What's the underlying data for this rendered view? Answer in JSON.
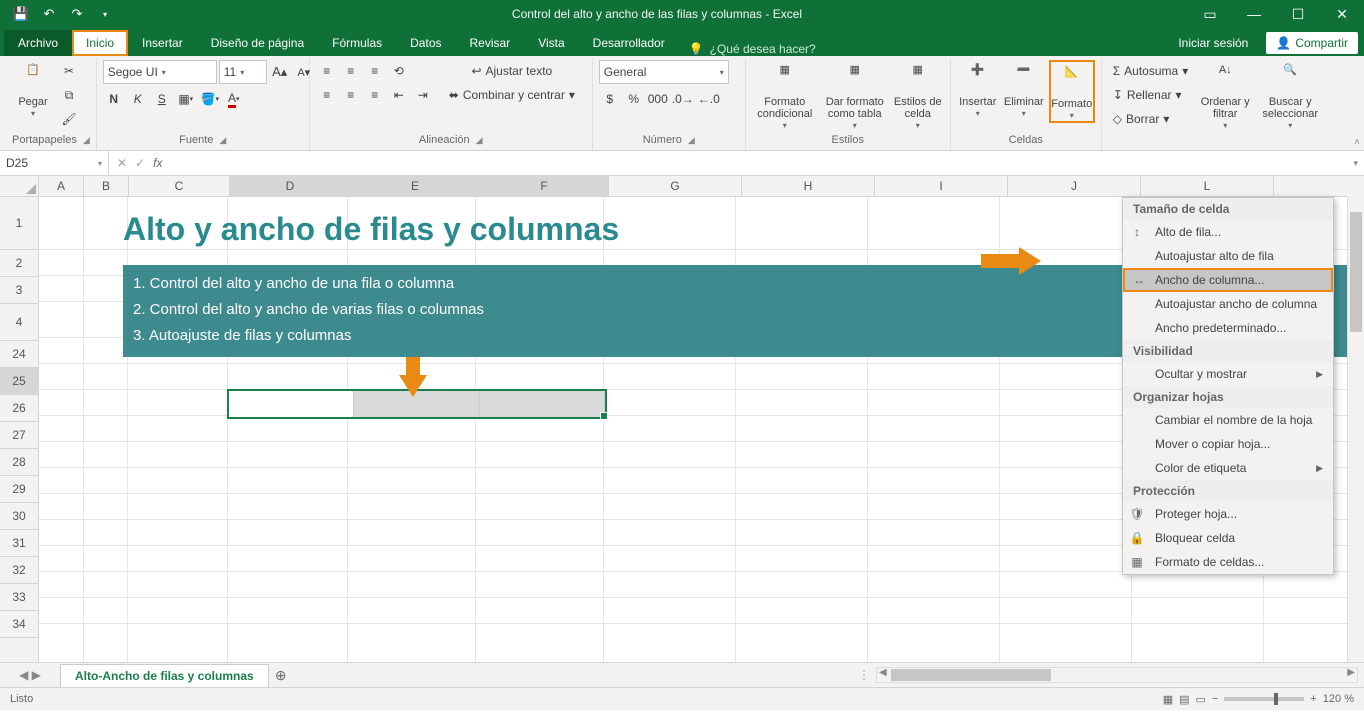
{
  "titlebar": {
    "title": "Control del alto y ancho de las filas y columnas - Excel"
  },
  "tabs": {
    "file": "Archivo",
    "list": [
      "Inicio",
      "Insertar",
      "Diseño de página",
      "Fórmulas",
      "Datos",
      "Revisar",
      "Vista",
      "Desarrollador"
    ],
    "active": "Inicio",
    "tellme_placeholder": "¿Qué desea hacer?",
    "signin": "Iniciar sesión",
    "share": "Compartir"
  },
  "ribbon": {
    "clipboard": {
      "paste": "Pegar",
      "label": "Portapapeles"
    },
    "font": {
      "name": "Segoe UI",
      "size": "11",
      "bold": "N",
      "italic": "K",
      "underline": "S",
      "label": "Fuente"
    },
    "alignment": {
      "wrap": "Ajustar texto",
      "merge": "Combinar y centrar",
      "label": "Alineación"
    },
    "number": {
      "format": "General",
      "label": "Número"
    },
    "styles": {
      "cond": "Formato condicional",
      "table": "Dar formato como tabla",
      "cell": "Estilos de celda",
      "label": "Estilos"
    },
    "cells": {
      "insert": "Insertar",
      "delete": "Eliminar",
      "format": "Formato",
      "label": "Celdas"
    },
    "editing": {
      "sum": "Autosuma",
      "fill": "Rellenar",
      "clear": "Borrar",
      "sort": "Ordenar y filtrar",
      "find": "Buscar y seleccionar"
    }
  },
  "namebox": {
    "ref": "D25"
  },
  "columns": [
    "A",
    "B",
    "C",
    "D",
    "E",
    "F",
    "G",
    "H",
    "I",
    "J",
    "L"
  ],
  "rows_top": [
    "1",
    "2",
    "3",
    "4"
  ],
  "rows_bottom": [
    "24",
    "25",
    "26",
    "27",
    "28",
    "29",
    "30",
    "31",
    "32",
    "33",
    "34"
  ],
  "sheet": {
    "title": "Alto y ancho de filas y columnas",
    "lines": [
      "1. Control del alto y ancho de una fila o columna",
      "2. Control del alto y ancho de varias filas o columnas",
      "3. Autoajuste de filas y columnas"
    ]
  },
  "menu": {
    "h1": "Tamaño de celda",
    "i1": "Alto de fila...",
    "i2": "Autoajustar alto de fila",
    "i3": "Ancho de columna...",
    "i4": "Autoajustar ancho de columna",
    "i5": "Ancho predeterminado...",
    "h2": "Visibilidad",
    "i6": "Ocultar y mostrar",
    "h3": "Organizar hojas",
    "i7": "Cambiar el nombre de la hoja",
    "i8": "Mover o copiar hoja...",
    "i9": "Color de etiqueta",
    "h4": "Protección",
    "i10": "Proteger hoja...",
    "i11": "Bloquear celda",
    "i12": "Formato de celdas..."
  },
  "sheettab": {
    "name": "Alto-Ancho de filas y columnas"
  },
  "status": {
    "ready": "Listo",
    "zoom": "120 %"
  }
}
